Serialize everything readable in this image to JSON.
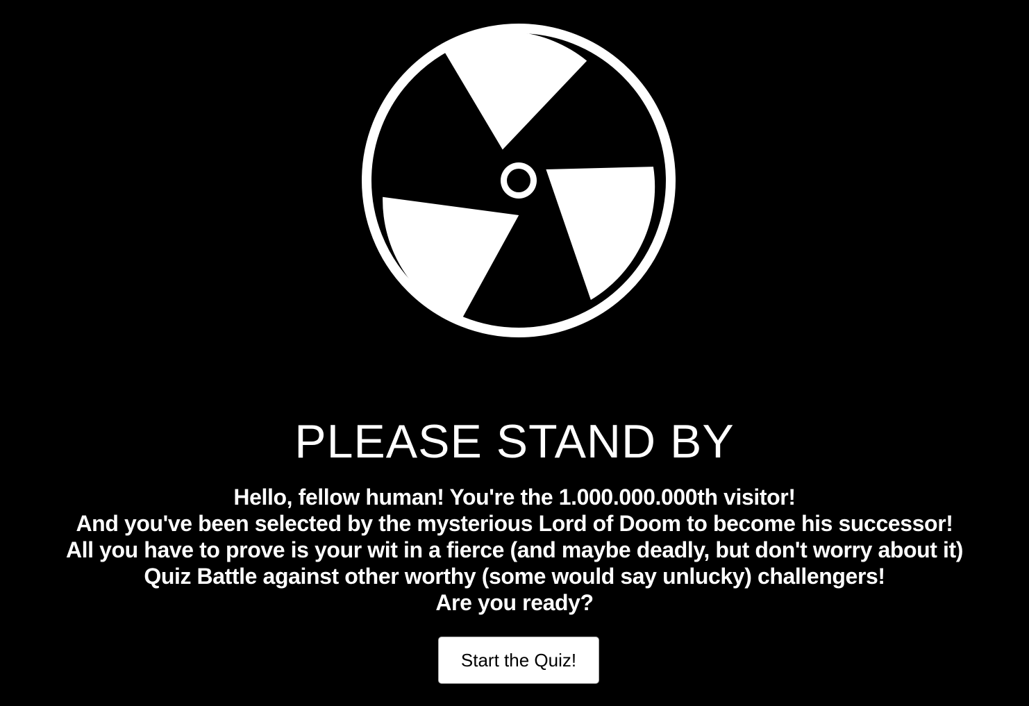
{
  "symbol": {
    "icon": "radiation-icon",
    "foreground": "#ffffff",
    "background": "#000000"
  },
  "headline": "PLEASE STAND BY",
  "message": {
    "lines": [
      "Hello, fellow human! You're the 1.000.000.000th visitor!",
      "And you've been selected by the mysterious Lord of Doom to become his successor!",
      "All you have to prove is your wit in a fierce (and maybe deadly, but don't worry about it)",
      "Quiz Battle against other worthy (some would say unlucky) challengers!",
      "Are you ready?"
    ]
  },
  "start_button": {
    "label": "Start the Quiz!"
  }
}
